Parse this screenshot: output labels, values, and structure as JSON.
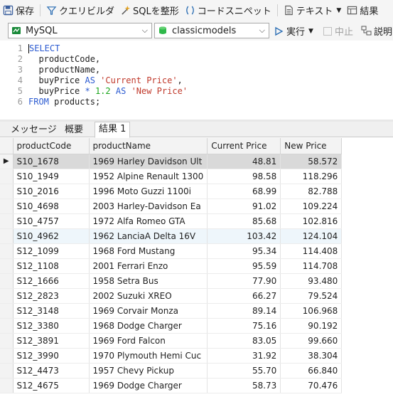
{
  "toolbar": {
    "save": "保存",
    "query_builder": "クエリビルダ",
    "sql_format": "SQLを整形",
    "code_snippet": "コードスニペット",
    "text": "テキスト",
    "results": "結果"
  },
  "connection": {
    "name": "MySQL"
  },
  "database": {
    "name": "classicmodels"
  },
  "run_bar": {
    "run": "実行",
    "stop": "中止",
    "explain": "説明"
  },
  "editor": {
    "lines": [
      {
        "no": "1",
        "text": "SELECT"
      },
      {
        "no": "2",
        "text": "productCode,"
      },
      {
        "no": "3",
        "text": "productName,"
      },
      {
        "no": "4",
        "text": "buyPrice",
        "as": "AS",
        "alias": "'Current Price'",
        "tail": ","
      },
      {
        "no": "5",
        "text": "buyPrice",
        "op": "*",
        "num": "1.2",
        "as": "AS",
        "alias": "'New Price'"
      },
      {
        "no": "6",
        "from": "FROM",
        "text": "products;"
      }
    ]
  },
  "tabs": [
    "メッセージ",
    "概要",
    "結果 1"
  ],
  "grid": {
    "columns": [
      "productCode",
      "productName",
      "Current Price",
      "New Price"
    ],
    "rows": [
      [
        "S10_1678",
        "1969 Harley Davidson Ult",
        "48.81",
        "58.572"
      ],
      [
        "S10_1949",
        "1952 Alpine Renault 1300",
        "98.58",
        "118.296"
      ],
      [
        "S10_2016",
        "1996 Moto Guzzi 1100i",
        "68.99",
        "82.788"
      ],
      [
        "S10_4698",
        "2003 Harley-Davidson Ea",
        "91.02",
        "109.224"
      ],
      [
        "S10_4757",
        "1972 Alfa Romeo GTA",
        "85.68",
        "102.816"
      ],
      [
        "S10_4962",
        "1962 LanciaA Delta 16V",
        "103.42",
        "124.104"
      ],
      [
        "S12_1099",
        "1968 Ford Mustang",
        "95.34",
        "114.408"
      ],
      [
        "S12_1108",
        "2001 Ferrari Enzo",
        "95.59",
        "114.708"
      ],
      [
        "S12_1666",
        "1958 Setra Bus",
        "77.90",
        "93.480"
      ],
      [
        "S12_2823",
        "2002 Suzuki XREO",
        "66.27",
        "79.524"
      ],
      [
        "S12_3148",
        "1969 Corvair Monza",
        "89.14",
        "106.968"
      ],
      [
        "S12_3380",
        "1968 Dodge Charger",
        "75.16",
        "90.192"
      ],
      [
        "S12_3891",
        "1969 Ford Falcon",
        "83.05",
        "99.660"
      ],
      [
        "S12_3990",
        "1970 Plymouth Hemi Cuc",
        "31.92",
        "38.304"
      ],
      [
        "S12_4473",
        "1957 Chevy Pickup",
        "55.70",
        "66.840"
      ],
      [
        "S12_4675",
        "1969 Dodge Charger",
        "58.73",
        "70.476"
      ]
    ]
  }
}
